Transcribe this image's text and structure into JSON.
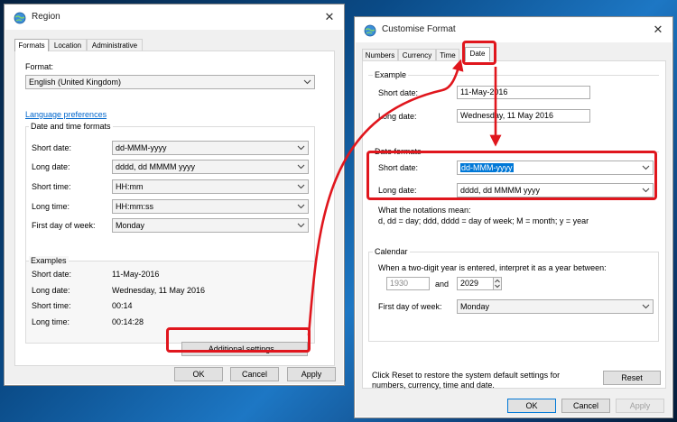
{
  "region": {
    "title": "Region",
    "tabs": [
      "Formats",
      "Location",
      "Administrative"
    ],
    "format_label": "Format:",
    "format_value": "English (United Kingdom)",
    "language_link": "Language preferences",
    "dt_formats_title": "Date and time formats",
    "rows": [
      {
        "label": "Short date:",
        "value": "dd-MMM-yyyy"
      },
      {
        "label": "Long date:",
        "value": "dddd, dd MMMM yyyy"
      },
      {
        "label": "Short time:",
        "value": "HH:mm"
      },
      {
        "label": "Long time:",
        "value": "HH:mm:ss"
      },
      {
        "label": "First day of week:",
        "value": "Monday"
      }
    ],
    "examples_title": "Examples",
    "examples": [
      {
        "label": "Short date:",
        "value": "11-May-2016"
      },
      {
        "label": "Long date:",
        "value": "Wednesday, 11 May 2016"
      },
      {
        "label": "Short time:",
        "value": "00:14"
      },
      {
        "label": "Long time:",
        "value": "00:14:28"
      }
    ],
    "additional_settings": "Additional settings...",
    "ok": "OK",
    "cancel": "Cancel",
    "apply": "Apply"
  },
  "customise": {
    "title": "Customise Format",
    "tabs": [
      "Numbers",
      "Currency",
      "Time",
      "Date"
    ],
    "example_title": "Example",
    "short_date_label": "Short date:",
    "short_date_example": "11-May-2016",
    "long_date_label": "Long date:",
    "long_date_example": "Wednesday, 11 May 2016",
    "date_formats_title": "Date formats",
    "short_date_format": "dd-MMM-yyyy",
    "long_date_format": "dddd, dd MMMM yyyy",
    "notations_title": "What the notations mean:",
    "notations_text": "d, dd = day;  ddd, dddd = day of week;  M = month;  y = year",
    "calendar_title": "Calendar",
    "two_digit_text": "When a two-digit year is entered, interpret it as a year between:",
    "year_from": "1930",
    "and_label": "and",
    "year_to": "2029",
    "first_day_label": "First day of week:",
    "first_day_value": "Monday",
    "reset_text": "Click Reset to restore the system default settings for numbers, currency, time and date.",
    "reset": "Reset",
    "ok": "OK",
    "cancel": "Cancel",
    "apply": "Apply"
  },
  "colors": {
    "highlight": "#e0161d",
    "selection": "#0078d7",
    "link": "#0066cc"
  }
}
